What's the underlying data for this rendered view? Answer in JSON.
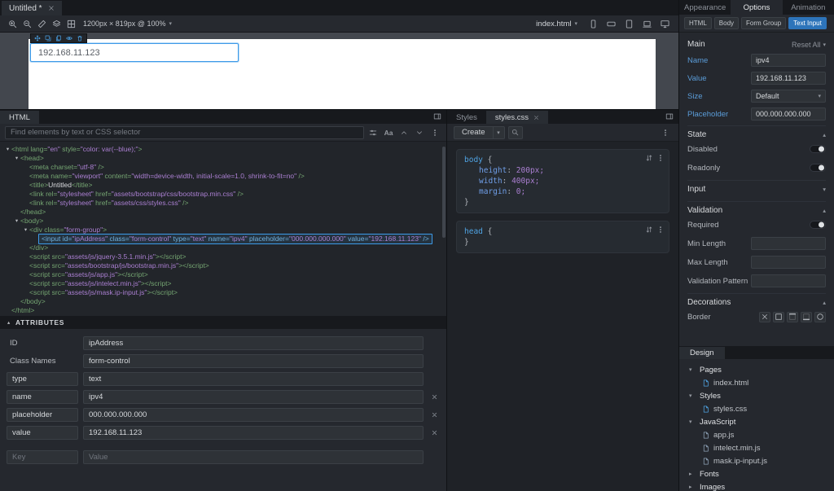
{
  "colors": {
    "accent": "#3d9ae8",
    "selection": "#2d74ba"
  },
  "window": {
    "tab": "Untitled *"
  },
  "toolbar": {
    "left_icons": [
      "zoom-in",
      "zoom-out",
      "measure",
      "layers",
      "grid"
    ],
    "viewport": "1200px × 819px @ 100%",
    "page_select": "index.html",
    "device_icons": [
      "phone",
      "phone-landscape",
      "tablet",
      "laptop",
      "desktop"
    ]
  },
  "canvas": {
    "element_toolbar_icons": [
      "move",
      "duplicate",
      "copy",
      "eye",
      "trash"
    ],
    "input_value": "192.168.11.123"
  },
  "html_panel": {
    "tab_label": "HTML",
    "search_placeholder": "Find elements by text or CSS selector",
    "tree": [
      {
        "indent": 0,
        "arrow": true,
        "tokens": [
          [
            "t",
            "<html lang="
          ],
          [
            "v",
            "\"en\""
          ],
          [
            "t",
            " style="
          ],
          [
            "v",
            "\"color: var(--blue);\""
          ],
          [
            "t",
            ">"
          ]
        ]
      },
      {
        "indent": 1,
        "arrow": true,
        "tokens": [
          [
            "t",
            "<head>"
          ]
        ]
      },
      {
        "indent": 2,
        "arrow": false,
        "tokens": [
          [
            "t",
            "<meta charset="
          ],
          [
            "v",
            "\"utf-8\""
          ],
          [
            "t",
            " />"
          ]
        ]
      },
      {
        "indent": 2,
        "arrow": false,
        "tokens": [
          [
            "t",
            "<meta name="
          ],
          [
            "v",
            "\"viewport\""
          ],
          [
            "t",
            " content="
          ],
          [
            "v",
            "\"width=device-width, initial-scale=1.0, shrink-to-fit=no\""
          ],
          [
            "t",
            " />"
          ]
        ]
      },
      {
        "indent": 2,
        "arrow": false,
        "tokens": [
          [
            "t",
            "<title>"
          ],
          [
            "x",
            "Untitled"
          ],
          [
            "t",
            "</title>"
          ]
        ]
      },
      {
        "indent": 2,
        "arrow": false,
        "tokens": [
          [
            "t",
            "<link rel="
          ],
          [
            "v",
            "\"stylesheet\""
          ],
          [
            "t",
            " href="
          ],
          [
            "v",
            "\"assets/bootstrap/css/bootstrap.min.css\""
          ],
          [
            "t",
            " />"
          ]
        ]
      },
      {
        "indent": 2,
        "arrow": false,
        "tokens": [
          [
            "t",
            "<link rel="
          ],
          [
            "v",
            "\"stylesheet\""
          ],
          [
            "t",
            " href="
          ],
          [
            "v",
            "\"assets/css/styles.css\""
          ],
          [
            "t",
            " />"
          ]
        ]
      },
      {
        "indent": 1,
        "arrow": false,
        "tokens": [
          [
            "t",
            "</head>"
          ]
        ]
      },
      {
        "indent": 1,
        "arrow": true,
        "tokens": [
          [
            "t",
            "<body>"
          ]
        ]
      },
      {
        "indent": 2,
        "arrow": true,
        "tokens": [
          [
            "t",
            "<div class="
          ],
          [
            "v",
            "\"form-group\""
          ],
          [
            "t",
            ">"
          ]
        ]
      },
      {
        "indent": 3,
        "arrow": false,
        "selected": true,
        "tokens": [
          [
            "t",
            "<input id="
          ],
          [
            "v",
            "\"ipAddress\""
          ],
          [
            "t",
            " class="
          ],
          [
            "v",
            "\"form-control\""
          ],
          [
            "t",
            " type="
          ],
          [
            "v",
            "\"text\""
          ],
          [
            "t",
            " name="
          ],
          [
            "v",
            "\"ipv4\""
          ],
          [
            "t",
            " placeholder="
          ],
          [
            "v",
            "\"000.000.000.000\""
          ],
          [
            "t",
            " value="
          ],
          [
            "v",
            "\"192.168.11.123\""
          ],
          [
            "t",
            " />"
          ]
        ]
      },
      {
        "indent": 2,
        "arrow": false,
        "tokens": [
          [
            "t",
            "</div>"
          ]
        ]
      },
      {
        "indent": 2,
        "arrow": false,
        "tokens": [
          [
            "t",
            "<script src="
          ],
          [
            "v",
            "\"assets/js/jquery-3.5.1.min.js\""
          ],
          [
            "t",
            "></script>"
          ]
        ]
      },
      {
        "indent": 2,
        "arrow": false,
        "tokens": [
          [
            "t",
            "<script src="
          ],
          [
            "v",
            "\"assets/bootstrap/js/bootstrap.min.js\""
          ],
          [
            "t",
            "></script>"
          ]
        ]
      },
      {
        "indent": 2,
        "arrow": false,
        "tokens": [
          [
            "t",
            "<script src="
          ],
          [
            "v",
            "\"assets/js/app.js\""
          ],
          [
            "t",
            "></script>"
          ]
        ]
      },
      {
        "indent": 2,
        "arrow": false,
        "tokens": [
          [
            "t",
            "<script src="
          ],
          [
            "v",
            "\"assets/js/intelect.min.js\""
          ],
          [
            "t",
            "></script>"
          ]
        ]
      },
      {
        "indent": 2,
        "arrow": false,
        "tokens": [
          [
            "t",
            "<script src="
          ],
          [
            "v",
            "\"assets/js/mask.ip-input.js\""
          ],
          [
            "t",
            "></script>"
          ]
        ]
      },
      {
        "indent": 1,
        "arrow": false,
        "tokens": [
          [
            "t",
            "</body>"
          ]
        ]
      },
      {
        "indent": 0,
        "arrow": false,
        "tokens": [
          [
            "t",
            "</html>"
          ]
        ]
      }
    ],
    "attributes": {
      "header": "ATTRIBUTES",
      "rows": [
        {
          "key": "ID",
          "key_editable": false,
          "value": "ipAddress",
          "removable": false
        },
        {
          "key": "Class Names",
          "key_editable": false,
          "value": "form-control",
          "removable": false
        },
        {
          "key": "type",
          "key_editable": true,
          "value": "text",
          "removable": false
        },
        {
          "key": "name",
          "key_editable": true,
          "value": "ipv4",
          "removable": true
        },
        {
          "key": "placeholder",
          "key_editable": true,
          "value": "000.000.000.000",
          "removable": true
        },
        {
          "key": "value",
          "key_editable": true,
          "value": "192.168.11.123",
          "removable": true
        }
      ],
      "new_row": {
        "key_placeholder": "Key",
        "value_placeholder": "Value"
      }
    }
  },
  "styles_panel": {
    "tab_styles": "Styles",
    "tab_file": "styles.css",
    "create_label": "Create",
    "blocks": [
      {
        "selector": "body",
        "props": [
          {
            "name": "height",
            "value": "200px"
          },
          {
            "name": "width",
            "value": "400px"
          },
          {
            "name": "margin",
            "value": "0"
          }
        ]
      },
      {
        "selector": "head",
        "props": []
      }
    ]
  },
  "options_panel": {
    "tabs": [
      "Appearance",
      "Options",
      "Animation"
    ],
    "active_tab": "Options",
    "breadcrumb": [
      {
        "label": "HTML",
        "active": false
      },
      {
        "label": "Body",
        "active": false
      },
      {
        "label": "Form Group",
        "active": false
      },
      {
        "label": "Text Input",
        "active": true
      }
    ],
    "main": {
      "title": "Main",
      "reset": "Reset All",
      "fields": [
        {
          "label": "Name",
          "type": "input",
          "value": "ipv4"
        },
        {
          "label": "Value",
          "type": "input",
          "value": "192.168.11.123"
        },
        {
          "label": "Size",
          "type": "select",
          "value": "Default"
        },
        {
          "label": "Placeholder",
          "type": "input",
          "value": "000.000.000.000"
        }
      ]
    },
    "sections": [
      {
        "title": "State",
        "expanded": true,
        "rows": [
          {
            "label": "Disabled",
            "control": "toggle",
            "on": false
          },
          {
            "label": "Readonly",
            "control": "toggle",
            "on": false
          }
        ]
      },
      {
        "title": "Input",
        "expanded": false,
        "rows": []
      },
      {
        "title": "Validation",
        "expanded": true,
        "rows": [
          {
            "label": "Required",
            "control": "toggle",
            "on": false
          },
          {
            "label": "Min Length",
            "control": "input",
            "value": ""
          },
          {
            "label": "Max Length",
            "control": "input",
            "value": ""
          },
          {
            "label": "Validation Pattern",
            "control": "input",
            "value": ""
          }
        ]
      },
      {
        "title": "Decorations",
        "expanded": true,
        "rows": [
          {
            "label": "Border",
            "control": "icons",
            "icons": [
              "none",
              "all",
              "top",
              "bottom",
              "radius"
            ]
          }
        ]
      }
    ]
  },
  "design_panel": {
    "title": "Design",
    "tree": [
      {
        "label": "Pages",
        "expanded": true,
        "children": [
          {
            "label": "index.html",
            "icon": "html-file"
          }
        ]
      },
      {
        "label": "Styles",
        "expanded": true,
        "children": [
          {
            "label": "styles.css",
            "icon": "css-file"
          }
        ]
      },
      {
        "label": "JavaScript",
        "expanded": true,
        "children": [
          {
            "label": "app.js",
            "icon": "js-file"
          },
          {
            "label": "intelect.min.js",
            "icon": "js-file"
          },
          {
            "label": "mask.ip-input.js",
            "icon": "js-file"
          }
        ]
      },
      {
        "label": "Fonts",
        "expanded": false,
        "children": []
      },
      {
        "label": "Images",
        "expanded": false,
        "children": []
      }
    ]
  }
}
